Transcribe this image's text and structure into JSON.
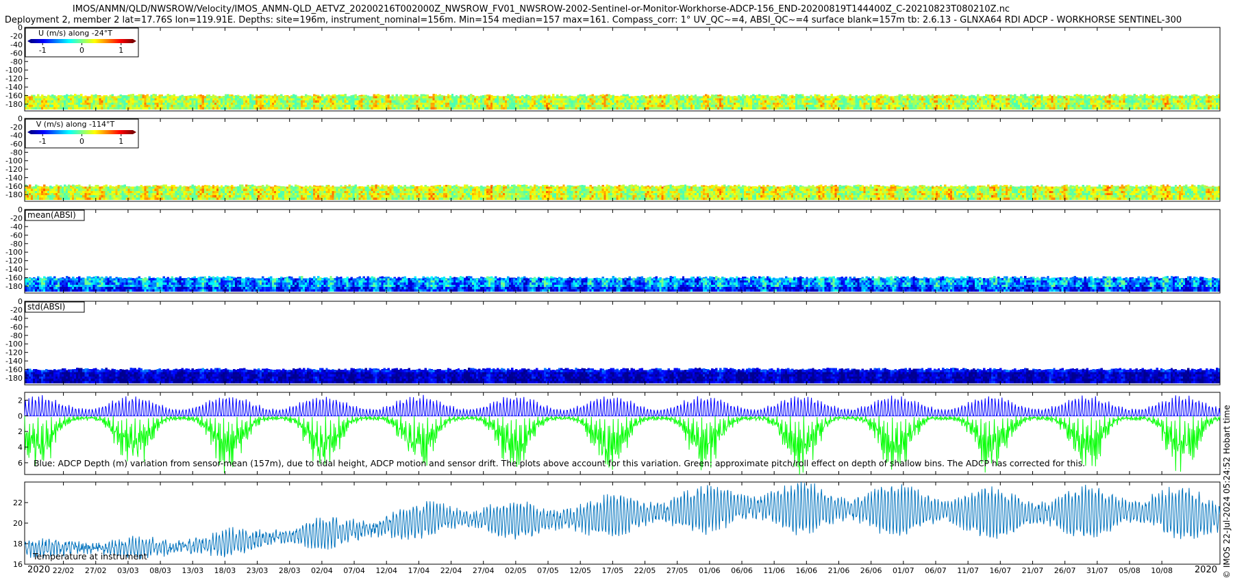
{
  "title_lines": [
    "IMOS/ANMN/QLD/NWSROW/Velocity/IMOS_ANMN-QLD_AETVZ_20200216T002000Z_NWSROW_FV01_NWSROW-2002-Sentinel-or-Monitor-Workhorse-ADCP-156_END-20200819T144400Z_C-20210823T080210Z.nc",
    "Deployment 2, member 2 lat=17.76S lon=119.91E. Depths: site=196m, instrument_nominal=156m. Min=154 median=157 max=161. Compass_corr: 1° UV_QC~=4, ABSI_QC~=4 surface blank=157m tb: 2.6.13 - GLNXA64 RDI ADCP - WORKHORSE SENTINEL-300"
  ],
  "credit": "© IMOS 22-Jul-2024 05:24:52 Hobart time",
  "colors": {
    "jet": [
      "#00008f",
      "#0000ff",
      "#0080ff",
      "#00ffff",
      "#80ff80",
      "#ffff00",
      "#ff8000",
      "#ff0000",
      "#800000"
    ],
    "tide_blue": "#0000ff",
    "tide_green": "#00ff00",
    "temperature": "#0072bd"
  },
  "chart_data": [
    {
      "type": "heatmap",
      "panel": "U",
      "ylim": [
        -196,
        0
      ],
      "yticks": [
        0,
        -20,
        -40,
        -60,
        -80,
        -100,
        -120,
        -140,
        -160,
        -180
      ],
      "data_depth_range": [
        -192,
        -156
      ],
      "colorbar": {
        "label": "U (m/s) along -24°T",
        "range": [
          -1.3,
          1.3
        ],
        "ticks": [
          -1,
          0,
          1
        ]
      },
      "x": "2020-02-16 to 2020-08-19"
    },
    {
      "type": "heatmap",
      "panel": "V",
      "ylim": [
        -196,
        0
      ],
      "yticks": [
        0,
        -20,
        -40,
        -60,
        -80,
        -100,
        -120,
        -140,
        -160,
        -180
      ],
      "data_depth_range": [
        -192,
        -156
      ],
      "colorbar": {
        "label": "V (m/s) along -114°T",
        "range": [
          -1.3,
          1.3
        ],
        "ticks": [
          -1,
          0,
          1
        ]
      },
      "x": "2020-02-16 to 2020-08-19"
    },
    {
      "type": "heatmap",
      "panel": "mean(ABSI)",
      "label": "mean(ABSI)",
      "ylim": [
        -196,
        0
      ],
      "yticks": [
        0,
        -20,
        -40,
        -60,
        -80,
        -100,
        -120,
        -140,
        -160,
        -180
      ],
      "data_depth_range": [
        -192,
        -156
      ],
      "x": "2020-02-16 to 2020-08-19"
    },
    {
      "type": "heatmap",
      "panel": "std(ABSI)",
      "label": "std(ABSI)",
      "ylim": [
        -196,
        0
      ],
      "yticks": [
        0,
        -20,
        -40,
        -60,
        -80,
        -100,
        -120,
        -140,
        -160,
        -180
      ],
      "data_depth_range": [
        -192,
        -156
      ],
      "x": "2020-02-16 to 2020-08-19"
    },
    {
      "type": "line",
      "panel": "depth variation",
      "ylim": [
        -7.5,
        3
      ],
      "yticks": [
        2,
        0,
        -2,
        -4,
        -6
      ],
      "ytick_labels": [
        "2",
        "0",
        "2",
        "4",
        "6"
      ],
      "series": [
        {
          "name": "Blue",
          "amplitude_range": [
            0.8,
            2.7
          ]
        },
        {
          "name": "Green",
          "amplitude_range": [
            -7.5,
            -0.2
          ]
        }
      ],
      "annotation": "Blue: ADCP Depth (m) variation from sensor-mean (157m), due to tidal height, ADCP motion and sensor drift. The plots above account for this variation. Green: approximate pitch/roll effect on depth of shallow bins. The ADCP has corrected for this."
    },
    {
      "type": "line",
      "panel": "temperature",
      "ylim": [
        16,
        24
      ],
      "yticks": [
        16,
        18,
        20,
        22
      ],
      "trend": [
        {
          "x": "2020-02-16",
          "y": 17.6
        },
        {
          "x": "2020-03-10",
          "y": 17.6
        },
        {
          "x": "2020-04-10",
          "y": 19.5
        },
        {
          "x": "2020-04-20",
          "y": 20.5
        },
        {
          "x": "2020-05-05",
          "y": 20.2
        },
        {
          "x": "2020-05-20",
          "y": 20.8
        },
        {
          "x": "2020-06-05",
          "y": 21.6
        },
        {
          "x": "2020-06-30",
          "y": 21.3
        },
        {
          "x": "2020-07-20",
          "y": 20.9
        },
        {
          "x": "2020-08-10",
          "y": 21.2
        },
        {
          "x": "2020-08-19",
          "y": 20.5
        }
      ],
      "annotation": "Temperature at instrument"
    }
  ],
  "x_axis": {
    "start": "2020-02-16",
    "end": "2020-08-19",
    "year_labels": [
      {
        "date": "2020-02-16",
        "label": "2020"
      },
      {
        "date": "2020-08-19",
        "label": "2020"
      }
    ],
    "ticks": [
      {
        "date": "2020-02-22",
        "label": "22/02"
      },
      {
        "date": "2020-02-27",
        "label": "27/02"
      },
      {
        "date": "2020-03-03",
        "label": "03/03"
      },
      {
        "date": "2020-03-08",
        "label": "08/03"
      },
      {
        "date": "2020-03-13",
        "label": "13/03"
      },
      {
        "date": "2020-03-18",
        "label": "18/03"
      },
      {
        "date": "2020-03-23",
        "label": "23/03"
      },
      {
        "date": "2020-03-28",
        "label": "28/03"
      },
      {
        "date": "2020-04-02",
        "label": "02/04"
      },
      {
        "date": "2020-04-07",
        "label": "07/04"
      },
      {
        "date": "2020-04-12",
        "label": "12/04"
      },
      {
        "date": "2020-04-17",
        "label": "17/04"
      },
      {
        "date": "2020-04-22",
        "label": "22/04"
      },
      {
        "date": "2020-04-27",
        "label": "27/04"
      },
      {
        "date": "2020-05-02",
        "label": "02/05"
      },
      {
        "date": "2020-05-07",
        "label": "07/05"
      },
      {
        "date": "2020-05-12",
        "label": "12/05"
      },
      {
        "date": "2020-05-17",
        "label": "17/05"
      },
      {
        "date": "2020-05-22",
        "label": "22/05"
      },
      {
        "date": "2020-05-27",
        "label": "27/05"
      },
      {
        "date": "2020-06-01",
        "label": "01/06"
      },
      {
        "date": "2020-06-06",
        "label": "06/06"
      },
      {
        "date": "2020-06-11",
        "label": "11/06"
      },
      {
        "date": "2020-06-16",
        "label": "16/06"
      },
      {
        "date": "2020-06-21",
        "label": "21/06"
      },
      {
        "date": "2020-06-26",
        "label": "26/06"
      },
      {
        "date": "2020-07-01",
        "label": "01/07"
      },
      {
        "date": "2020-07-06",
        "label": "06/07"
      },
      {
        "date": "2020-07-11",
        "label": "11/07"
      },
      {
        "date": "2020-07-16",
        "label": "16/07"
      },
      {
        "date": "2020-07-21",
        "label": "21/07"
      },
      {
        "date": "2020-07-26",
        "label": "26/07"
      },
      {
        "date": "2020-07-31",
        "label": "31/07"
      },
      {
        "date": "2020-08-05",
        "label": "05/08"
      },
      {
        "date": "2020-08-10",
        "label": "10/08"
      }
    ]
  }
}
